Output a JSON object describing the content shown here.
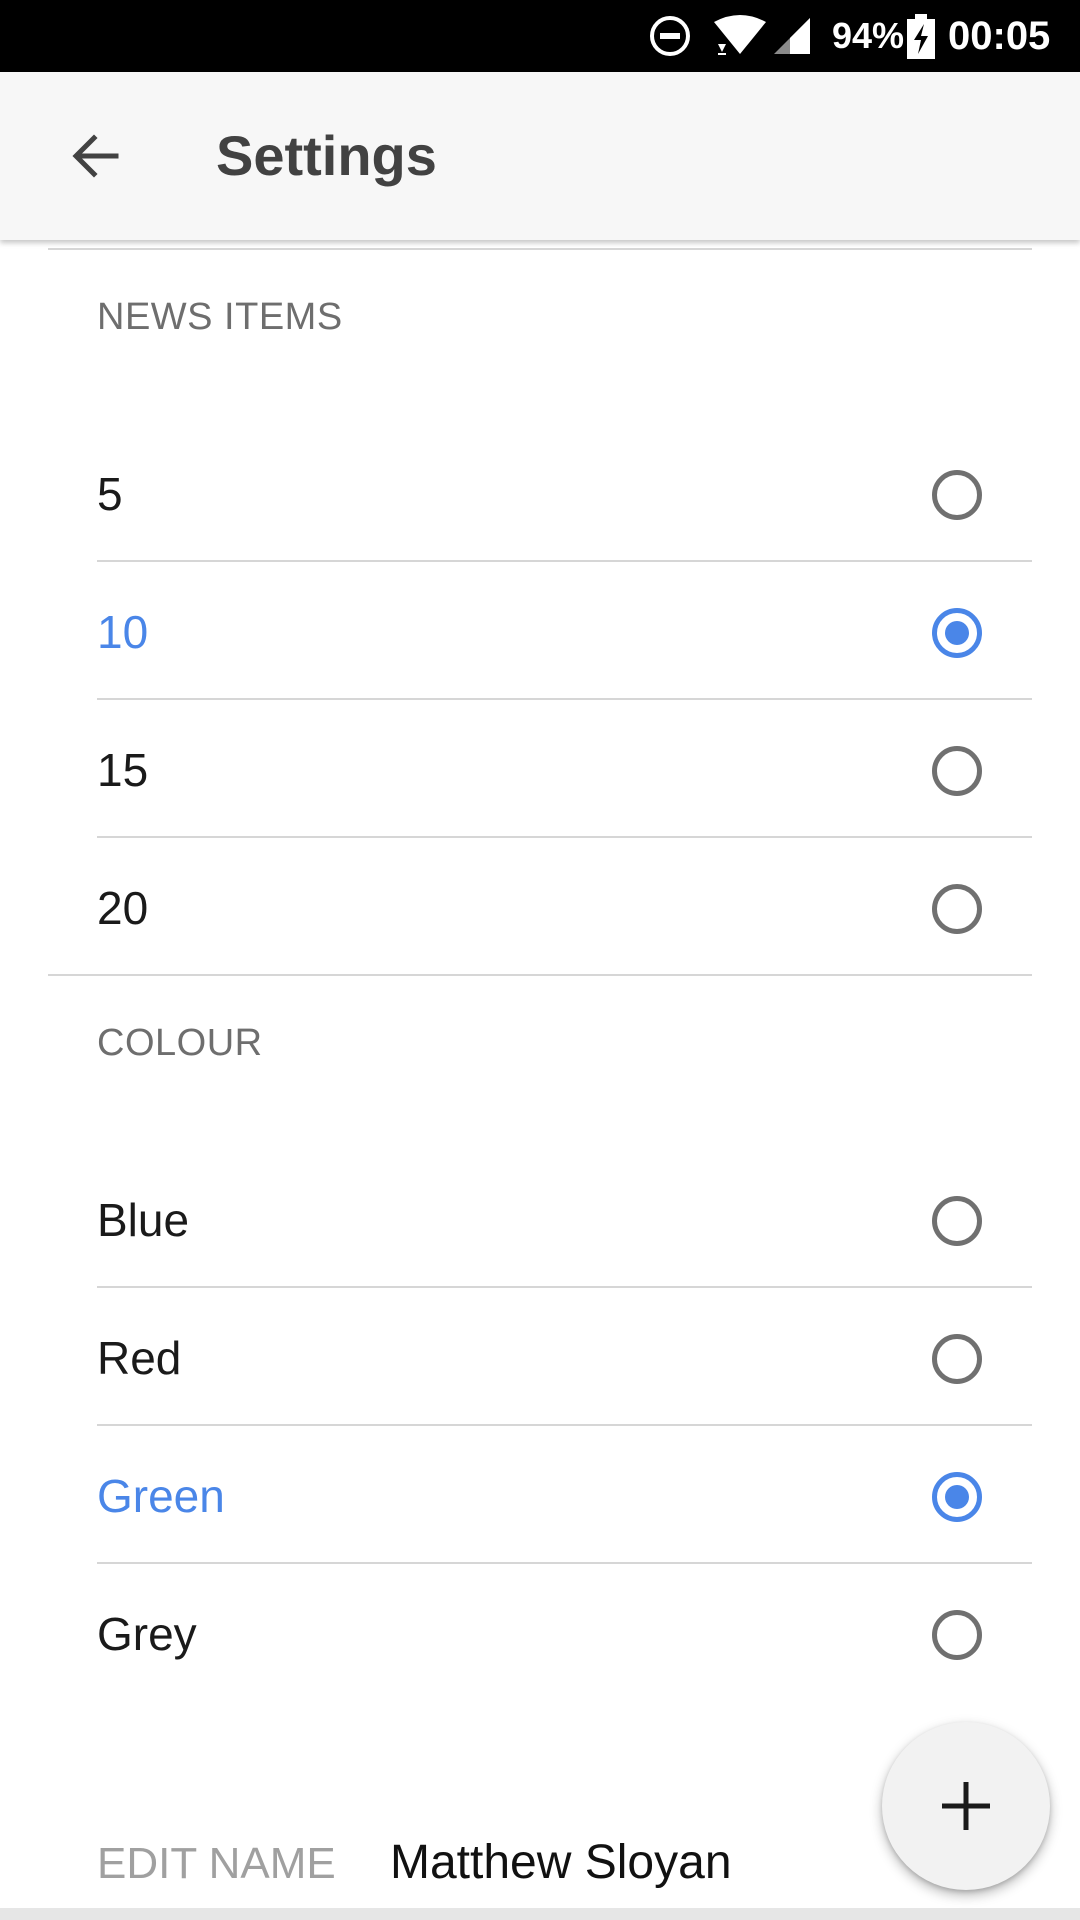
{
  "status_bar": {
    "battery": "94%",
    "time": "00:05",
    "icons": [
      "do-not-disturb-icon",
      "wifi-icon",
      "cell-signal-icon",
      "battery-charging-icon"
    ]
  },
  "app_bar": {
    "title": "Settings",
    "back_icon": "arrow-back-icon"
  },
  "news_items": {
    "header": "NEWS ITEMS",
    "options": [
      {
        "label": "5",
        "selected": false
      },
      {
        "label": "10",
        "selected": true
      },
      {
        "label": "15",
        "selected": false
      },
      {
        "label": "20",
        "selected": false
      }
    ]
  },
  "colour": {
    "header": "COLOUR",
    "options": [
      {
        "label": "Blue",
        "selected": false
      },
      {
        "label": "Red",
        "selected": false
      },
      {
        "label": "Green",
        "selected": true
      },
      {
        "label": "Grey",
        "selected": false
      }
    ]
  },
  "edit_name": {
    "label": "EDIT NAME",
    "value": "Matthew Sloyan"
  },
  "fab": {
    "icon": "plus-icon"
  },
  "colors": {
    "accent": "#4a86e8",
    "text_primary": "#1a1a1a",
    "text_secondary": "#6e6e6e",
    "divider": "#d6d6d6"
  }
}
